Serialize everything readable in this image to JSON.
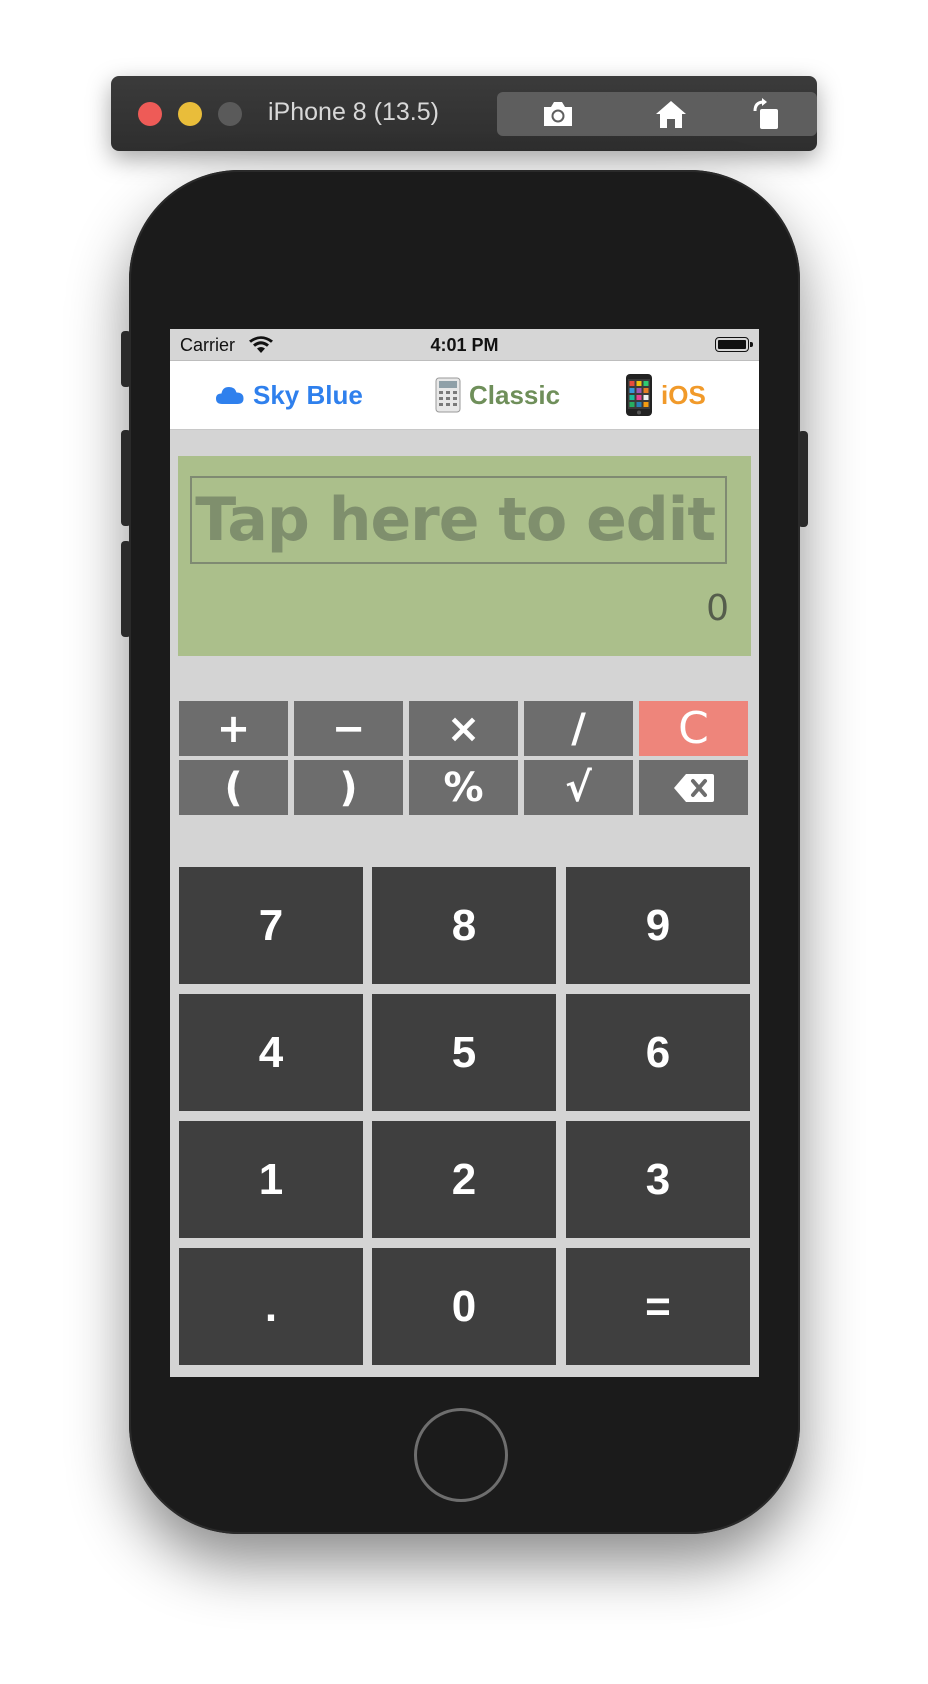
{
  "simulator": {
    "title": "iPhone 8 (13.5)",
    "buttons": [
      "camera-icon",
      "home-icon",
      "rotate-icon"
    ]
  },
  "status_bar": {
    "carrier": "Carrier",
    "time": "4:01 PM"
  },
  "themes": [
    {
      "icon": "cloud-icon",
      "label": "Sky Blue",
      "color": "#2f80ed"
    },
    {
      "icon": "calculator-icon",
      "label": "Classic",
      "color": "#6f8f5a"
    },
    {
      "icon": "phone-icon",
      "label": "iOS",
      "color": "#f19a2a"
    }
  ],
  "display": {
    "edit_placeholder": "Tap here to edit",
    "result": "0",
    "background": "#abbf8b"
  },
  "operator_keys": {
    "row1": [
      "+",
      "−",
      "×",
      "/",
      "C"
    ],
    "row2": [
      "(",
      ")",
      "%",
      "√",
      "backspace-icon"
    ]
  },
  "number_keys": [
    [
      "7",
      "8",
      "9"
    ],
    [
      "4",
      "5",
      "6"
    ],
    [
      "1",
      "2",
      "3"
    ],
    [
      ".",
      "0",
      "="
    ]
  ],
  "colors": {
    "operator_key": "#6d6d6d",
    "clear_key": "#ee857b",
    "number_key": "#3f3f3f"
  }
}
